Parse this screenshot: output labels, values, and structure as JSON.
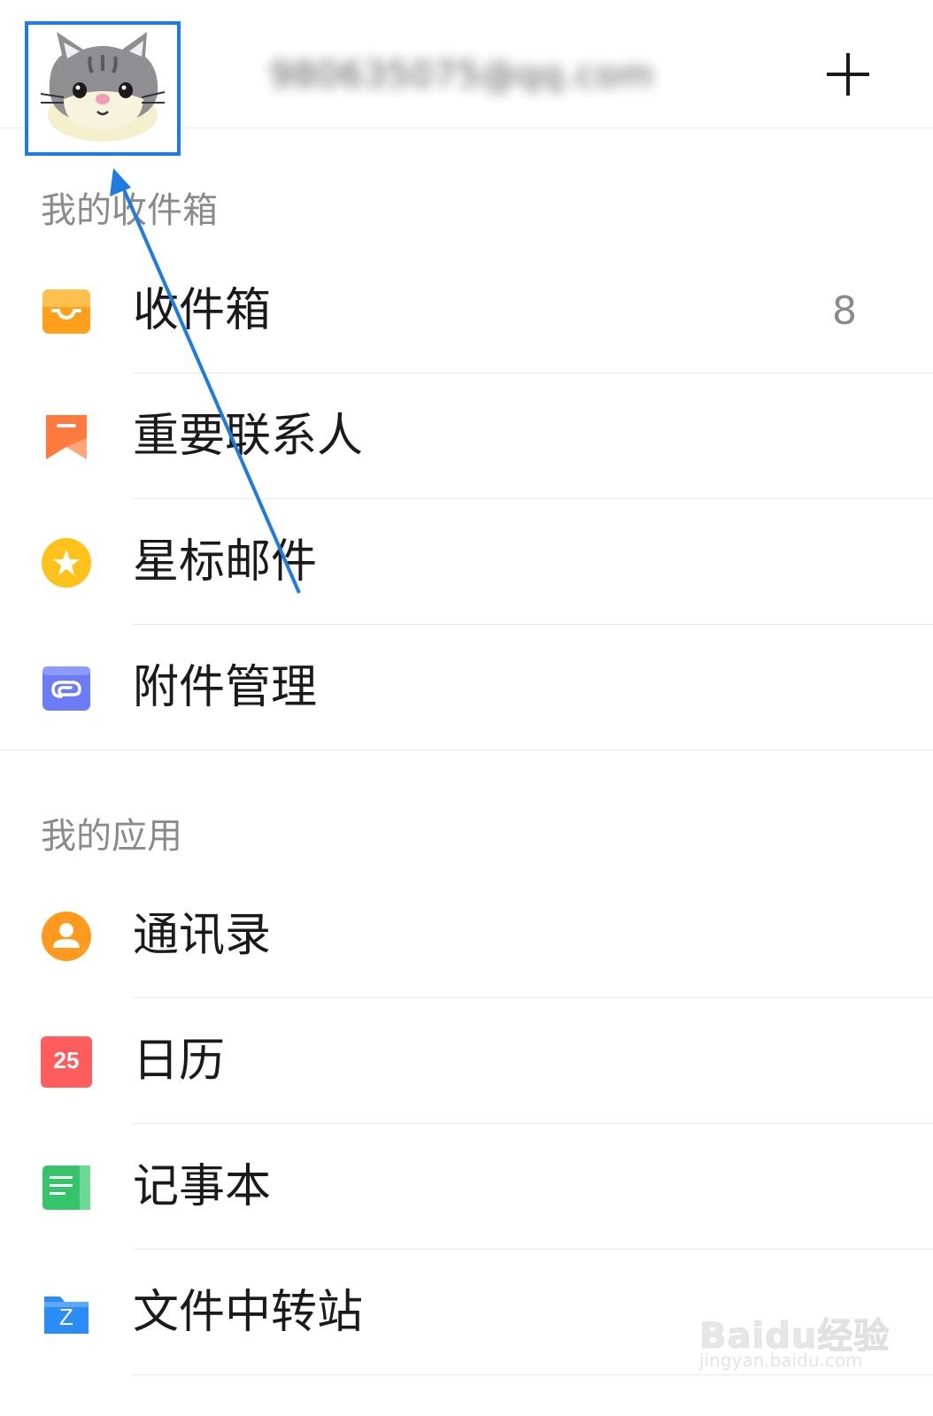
{
  "header": {
    "account_email": "980635075@qq.com",
    "add_label": "+"
  },
  "sections": {
    "mailbox_title": "我的收件箱",
    "apps_title": "我的应用"
  },
  "mailbox_items": [
    {
      "label": "收件箱",
      "count": "8",
      "icon": "inbox-icon",
      "color": "#ff9f1a"
    },
    {
      "label": "重要联系人",
      "icon": "bookmark-icon",
      "color": "#ff7a3d"
    },
    {
      "label": "星标邮件",
      "icon": "star-icon",
      "color": "#ffc21a"
    },
    {
      "label": "附件管理",
      "icon": "attachment-icon",
      "color": "#6b7cf5"
    }
  ],
  "app_items": [
    {
      "label": "通讯录",
      "icon": "contacts-icon",
      "color": "#ff9a1f"
    },
    {
      "label": "日历",
      "icon": "calendar-icon",
      "color": "#ff5c5c",
      "icon_text": "25"
    },
    {
      "label": "记事本",
      "icon": "notepad-icon",
      "color": "#35c46a"
    },
    {
      "label": "文件中转站",
      "icon": "transfer-folder-icon",
      "color": "#2a8cf5",
      "icon_text": "Z"
    }
  ],
  "watermark": {
    "brand": "Baidu经验",
    "url": "jingyan.baidu.com"
  },
  "annotation": {
    "highlight_color": "#1e7ce0"
  }
}
